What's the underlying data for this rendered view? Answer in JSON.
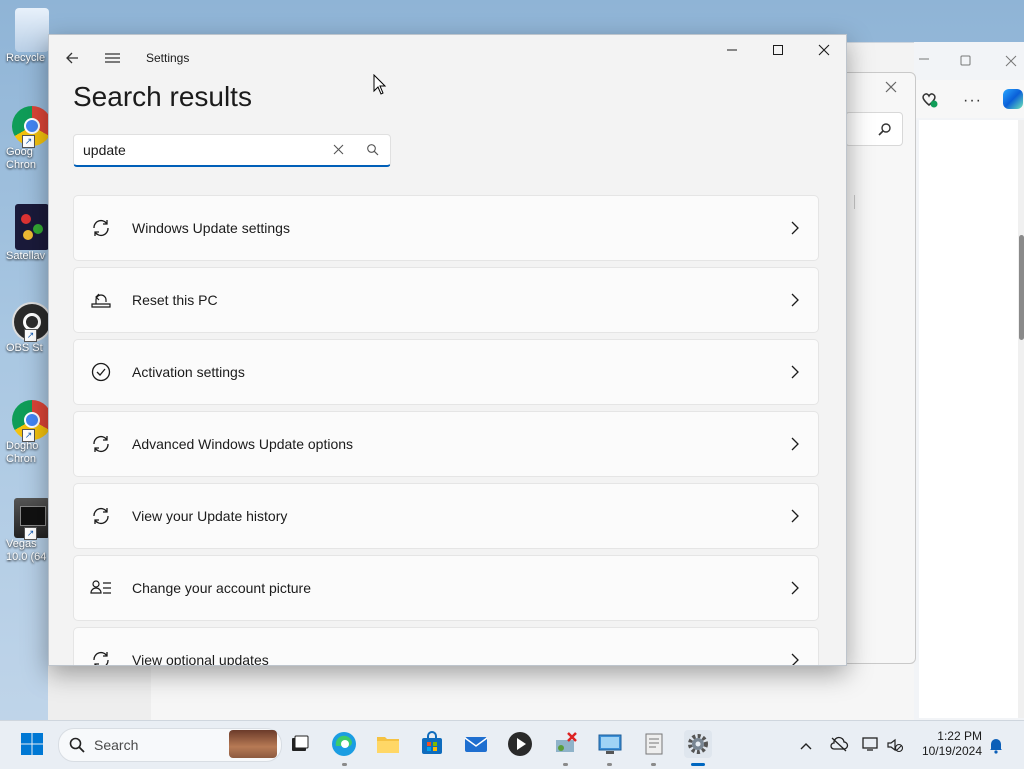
{
  "desktop": {
    "icons": [
      {
        "name": "recycle-bin",
        "label": "Recycle"
      },
      {
        "name": "google-chrome",
        "label": "Goog\nChron"
      },
      {
        "name": "satellaview",
        "label": "Satellav"
      },
      {
        "name": "obs-studio",
        "label": "OBS St"
      },
      {
        "name": "doghouse-chrome",
        "label": "Dogho\nChron"
      },
      {
        "name": "vegas",
        "label": "Vegas\n10.0 (64"
      }
    ]
  },
  "settings": {
    "title": "Settings",
    "heading": "Search results",
    "search": {
      "value": "update",
      "placeholder": ""
    },
    "results": [
      {
        "label": "Windows Update settings",
        "icon": "sync-icon"
      },
      {
        "label": "Reset this PC",
        "icon": "reset-pc-icon"
      },
      {
        "label": "Activation settings",
        "icon": "check-circle-icon"
      },
      {
        "label": "Advanced Windows Update options",
        "icon": "sync-icon"
      },
      {
        "label": "View your Update history",
        "icon": "sync-icon"
      },
      {
        "label": "Change your account picture",
        "icon": "account-list-icon"
      },
      {
        "label": "View optional updates",
        "icon": "sync-icon"
      }
    ]
  },
  "taskbar": {
    "search_label": "Search",
    "time": "1:22 PM",
    "date": "10/19/2024"
  },
  "colors": {
    "accent": "#005fb8",
    "taskbar": "#e9eef4",
    "window_bg": "#f3f3f3"
  }
}
